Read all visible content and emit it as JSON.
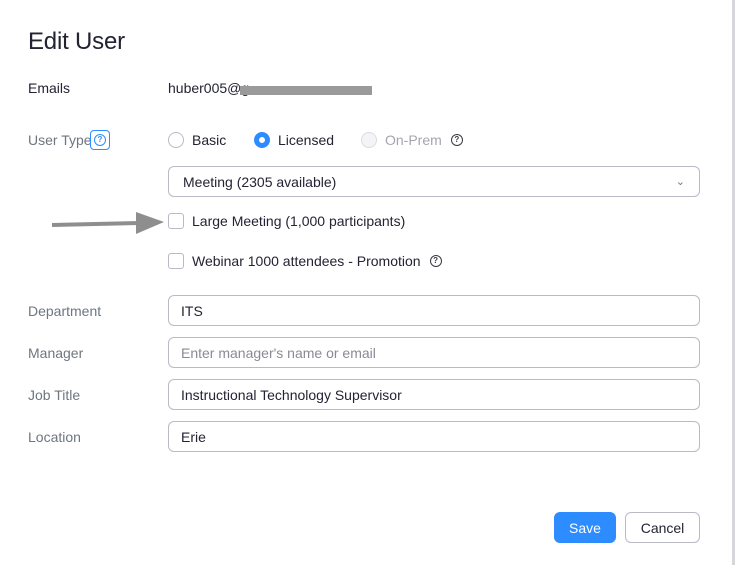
{
  "dialog": {
    "title": "Edit User"
  },
  "emails": {
    "label": "Emails",
    "value": "huber005@g"
  },
  "user_type": {
    "label": "User Type",
    "help_icon": "question-circle-icon",
    "options": [
      {
        "label": "Basic",
        "state": "unchecked"
      },
      {
        "label": "Licensed",
        "state": "checked"
      },
      {
        "label": "On-Prem",
        "state": "disabled"
      }
    ]
  },
  "meeting_select": {
    "value": "Meeting (2305 available)",
    "icon": "chevron-down-icon"
  },
  "addons": {
    "large_meeting": "Large Meeting (1,000 participants)",
    "webinar": "Webinar 1000 attendees - Promotion"
  },
  "fields": {
    "department": {
      "label": "Department",
      "value": "ITS"
    },
    "manager": {
      "label": "Manager",
      "value": "",
      "placeholder": "Enter manager's name or email"
    },
    "job_title": {
      "label": "Job Title",
      "value": "Instructional Technology Supervisor"
    },
    "location": {
      "label": "Location",
      "value": "Erie"
    }
  },
  "buttons": {
    "save": "Save",
    "cancel": "Cancel"
  },
  "colors": {
    "accent": "#2d8cff",
    "annotation_arrow": "#8e8e8e"
  }
}
